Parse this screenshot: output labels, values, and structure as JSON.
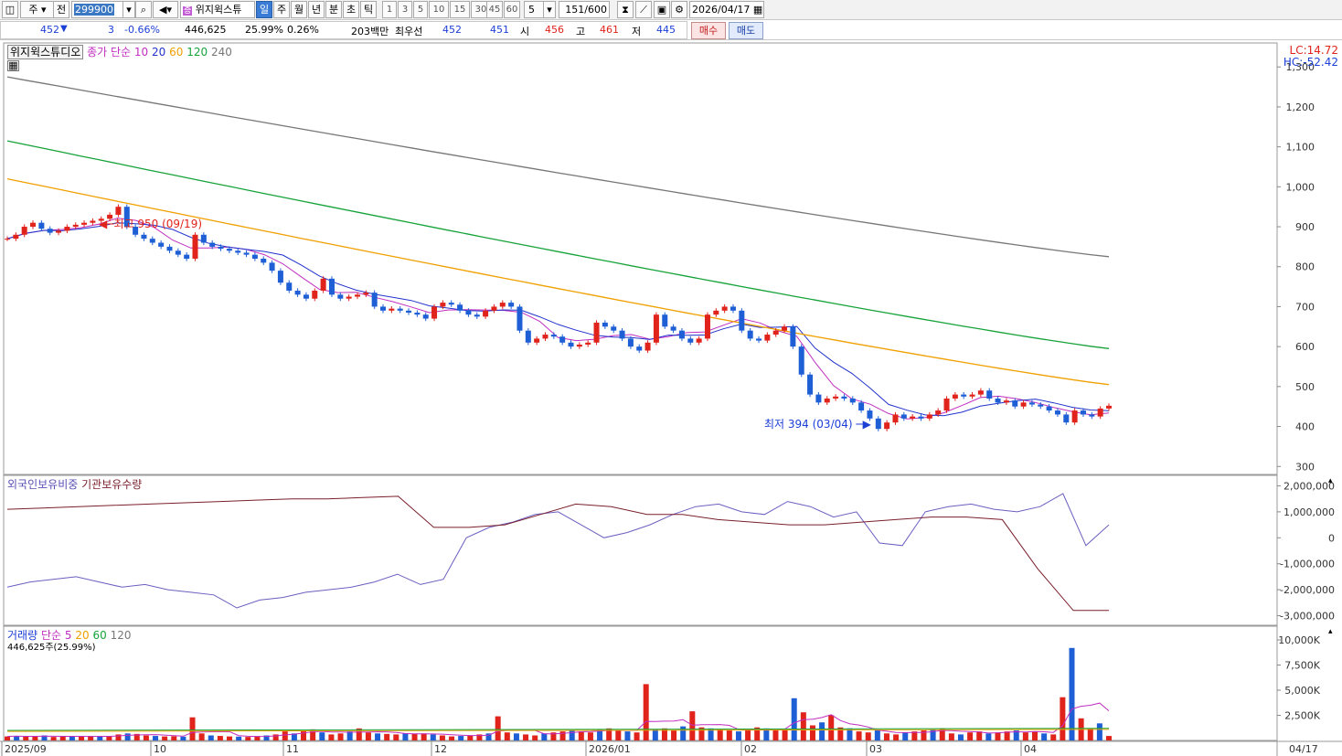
{
  "toolbar": {
    "period_type": "주",
    "period_all": "전",
    "code": "299900",
    "name": "위지윅스튜",
    "name_badge": "증",
    "tabs": [
      "일",
      "주",
      "월",
      "년",
      "분",
      "초",
      "틱"
    ],
    "active_tab": "일",
    "intervals": [
      "1",
      "3",
      "5",
      "10",
      "15",
      "30",
      "45",
      "60"
    ],
    "count_select": "5",
    "page_count": "151",
    "page_total": "/600",
    "date": "2026/04/17"
  },
  "quote": {
    "price": "452",
    "direction_icon": "down-triangle-icon",
    "change": "3",
    "change_pct": "-0.66%",
    "volume": "446,625",
    "vol_ratio": "25.99%",
    "turnover_pct": "0.26%",
    "amount": "203백만",
    "best_label": "최우선",
    "best_ask": "452",
    "best_bid": "451",
    "open_label": "시",
    "open": "456",
    "high_label": "고",
    "high": "461",
    "low_label": "저",
    "low": "445",
    "buy_label": "매수",
    "sell_label": "매도"
  },
  "price_panel": {
    "stock_label": "위지윅스튜디오",
    "legend_prefix": "종가 단순",
    "ma": [
      {
        "label": "10",
        "color": "#2233cc"
      },
      {
        "label": "20",
        "color": "#2233cc"
      },
      {
        "label": "60",
        "color": "#f0a000"
      },
      {
        "label": "120",
        "color": "#16a33a"
      },
      {
        "label": "240",
        "color": "#777777"
      }
    ],
    "lc": "LC:14.72",
    "hc": "HC:-52.42",
    "high_note": "최고 950 (09/19)",
    "low_note": "최저 394 (03/04)",
    "y_ticks": [
      "1,300",
      "1,200",
      "1,100",
      "1,000",
      "900",
      "800",
      "700",
      "600",
      "500",
      "400",
      "300"
    ]
  },
  "holding_panel": {
    "foreign_label": "외국인보유비중",
    "inst_label": "기관보유수량",
    "y_ticks": [
      "2,000,000",
      "1,000,000",
      "0",
      "-1,000,000",
      "-2,000,000",
      "-3,000,000"
    ]
  },
  "volume_panel": {
    "label": "거래량",
    "ma_prefix": "단순",
    "ma": [
      {
        "label": "5",
        "color": "#c02ec0"
      },
      {
        "label": "20",
        "color": "#f0a000"
      },
      {
        "label": "60",
        "color": "#16a33a"
      },
      {
        "label": "120",
        "color": "#777777"
      }
    ],
    "current": "446,625주(25.99%)",
    "y_ticks": [
      "10,000K",
      "7,500K",
      "5,000K",
      "2,500K"
    ]
  },
  "x_axis": {
    "ticks": [
      "2025/09",
      "10",
      "11",
      "12",
      "2026/01",
      "02",
      "03",
      "04"
    ],
    "last": "04/17"
  },
  "chart_data": [
    {
      "type": "candlestick",
      "title": "위지윅스튜디오",
      "x_range": [
        "2025/09",
        "2026/04/17"
      ],
      "ylim": [
        280,
        1360
      ],
      "y_ticks": [
        300,
        400,
        500,
        600,
        700,
        800,
        900,
        1000,
        1100,
        1200,
        1300
      ],
      "closes": [
        870,
        880,
        900,
        910,
        895,
        885,
        890,
        900,
        905,
        910,
        915,
        920,
        930,
        950,
        900,
        880,
        870,
        860,
        850,
        840,
        830,
        820,
        880,
        860,
        850,
        845,
        840,
        835,
        830,
        820,
        810,
        790,
        760,
        740,
        730,
        720,
        740,
        770,
        730,
        720,
        725,
        730,
        735,
        700,
        690,
        695,
        690,
        685,
        680,
        670,
        700,
        710,
        705,
        690,
        680,
        675,
        690,
        700,
        710,
        700,
        640,
        610,
        620,
        630,
        625,
        610,
        600,
        605,
        610,
        660,
        650,
        640,
        620,
        600,
        590,
        610,
        680,
        650,
        640,
        620,
        610,
        620,
        680,
        690,
        700,
        690,
        640,
        620,
        615,
        630,
        640,
        650,
        600,
        530,
        480,
        460,
        470,
        475,
        470,
        460,
        440,
        420,
        394,
        410,
        430,
        420,
        425,
        420,
        430,
        440,
        470,
        480,
        475,
        480,
        490,
        470,
        460,
        465,
        450,
        460,
        455,
        450,
        440,
        430,
        410,
        440,
        430,
        425,
        445,
        452
      ],
      "ma_series": [
        {
          "name": "10",
          "values_start": 880,
          "values_end": 450
        },
        {
          "name": "20",
          "values_start": 885,
          "values_end": 445
        },
        {
          "name": "60",
          "values_start": 1020,
          "values_end": 505
        },
        {
          "name": "120",
          "values_start": 1115,
          "values_end": 595
        },
        {
          "name": "240",
          "values_start": 1275,
          "values_end": 825
        }
      ],
      "annotations": [
        {
          "text": "최고 950 (09/19)",
          "value": 950
        },
        {
          "text": "최저 394 (03/04)",
          "value": 394
        }
      ]
    },
    {
      "type": "line",
      "series": [
        {
          "name": "외국인보유비중",
          "values": [
            -1900000,
            -1700000,
            -1600000,
            -1500000,
            -1700000,
            -1900000,
            -1800000,
            -2000000,
            -2100000,
            -2200000,
            -2700000,
            -2400000,
            -2300000,
            -2100000,
            -2000000,
            -1900000,
            -1700000,
            -1400000,
            -1800000,
            -1600000,
            0,
            400000,
            600000,
            900000,
            1000000,
            500000,
            0,
            200000,
            500000,
            900000,
            1200000,
            1300000,
            1000000,
            900000,
            1400000,
            1200000,
            800000,
            1000000,
            -200000,
            -300000,
            1000000,
            1200000,
            1300000,
            1100000,
            1000000,
            1200000,
            1700000,
            -300000,
            500000
          ]
        },
        {
          "name": "기관보유수량",
          "values": [
            1100000,
            1150000,
            1200000,
            1250000,
            1300000,
            1350000,
            1400000,
            1450000,
            1500000,
            1500000,
            1550000,
            1600000,
            400000,
            400000,
            500000,
            900000,
            1300000,
            1200000,
            900000,
            900000,
            700000,
            600000,
            500000,
            500000,
            600000,
            700000,
            800000,
            800000,
            700000,
            -1200000,
            -2800000,
            -2800000
          ]
        }
      ],
      "ylim": [
        -3300000,
        2300000
      ],
      "y_ticks": [
        -3000000,
        -2000000,
        -1000000,
        0,
        1000000,
        2000000
      ]
    },
    {
      "type": "bar",
      "title": "거래량",
      "ylim": [
        0,
        11000
      ],
      "unit": "K",
      "current_value": 446.625,
      "values": [
        400,
        450,
        380,
        420,
        500,
        350,
        400,
        380,
        420,
        450,
        400,
        380,
        600,
        700,
        650,
        500,
        450,
        400,
        420,
        380,
        2300,
        700,
        500,
        450,
        400,
        380,
        350,
        420,
        500,
        600,
        900,
        700,
        1000,
        1100,
        800,
        600,
        700,
        900,
        1200,
        800,
        700,
        650,
        600,
        700,
        650,
        700,
        600,
        500,
        400,
        450,
        500,
        600,
        700,
        2400,
        800,
        700,
        600,
        500,
        700,
        800,
        900,
        1000,
        900,
        800,
        1100,
        1200,
        1000,
        900,
        800,
        5600,
        1100,
        1200,
        1000,
        1400,
        2900,
        1300,
        1200,
        1100,
        1000,
        900,
        1100,
        1300,
        1200,
        1000,
        1100,
        4200,
        2800,
        1500,
        1800,
        2500,
        1300,
        1200,
        900,
        800,
        1000,
        700,
        600,
        800,
        900,
        1000,
        1100,
        1200,
        700,
        600,
        800,
        900,
        700,
        800,
        900,
        1000,
        800,
        900,
        700,
        600,
        4300,
        9200,
        2200,
        1200,
        1700,
        446
      ]
    }
  ]
}
